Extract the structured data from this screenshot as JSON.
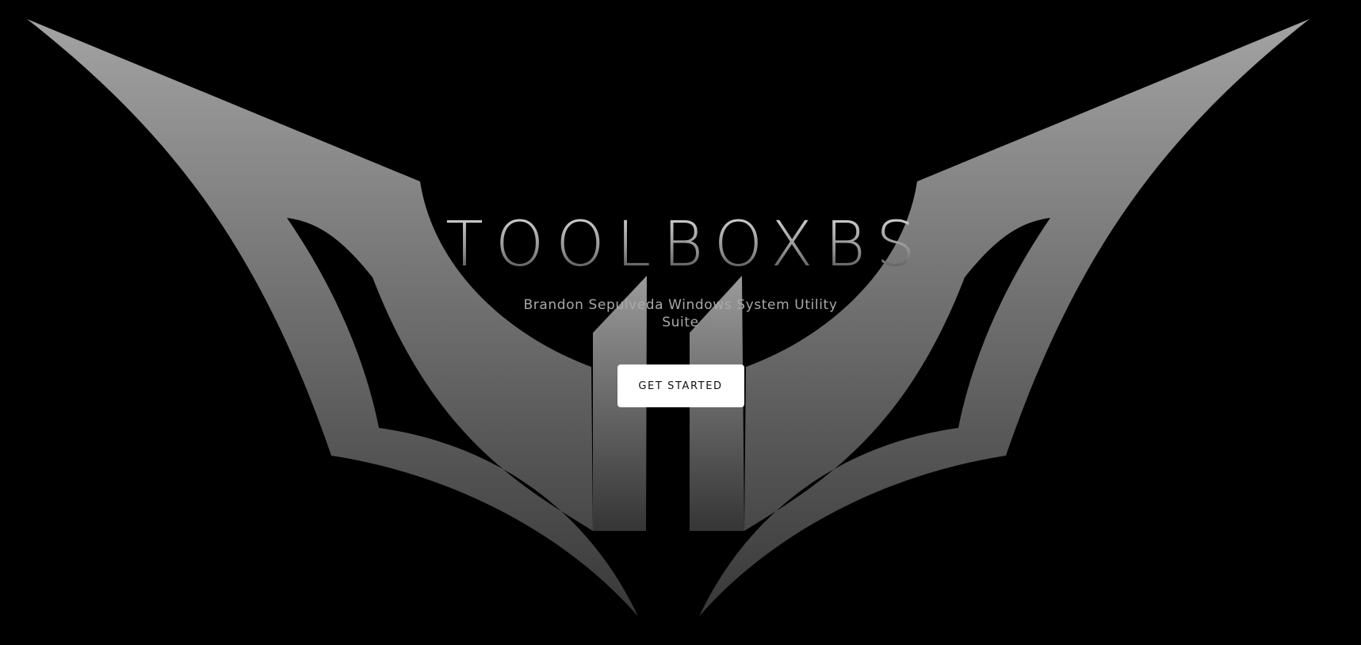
{
  "hero": {
    "title": "TOOLBOXBS",
    "subtitle": "Brandon Sepulveda Windows System Utility Suite",
    "cta_label": "GET STARTED"
  },
  "theme": {
    "background": "#000000",
    "emblem_top": "#a0a0a0",
    "emblem_bottom": "#3a3a3a",
    "button_bg": "#ffffff",
    "button_text": "#111111"
  },
  "icons": {
    "emblem": "bat-wing-emblem"
  }
}
